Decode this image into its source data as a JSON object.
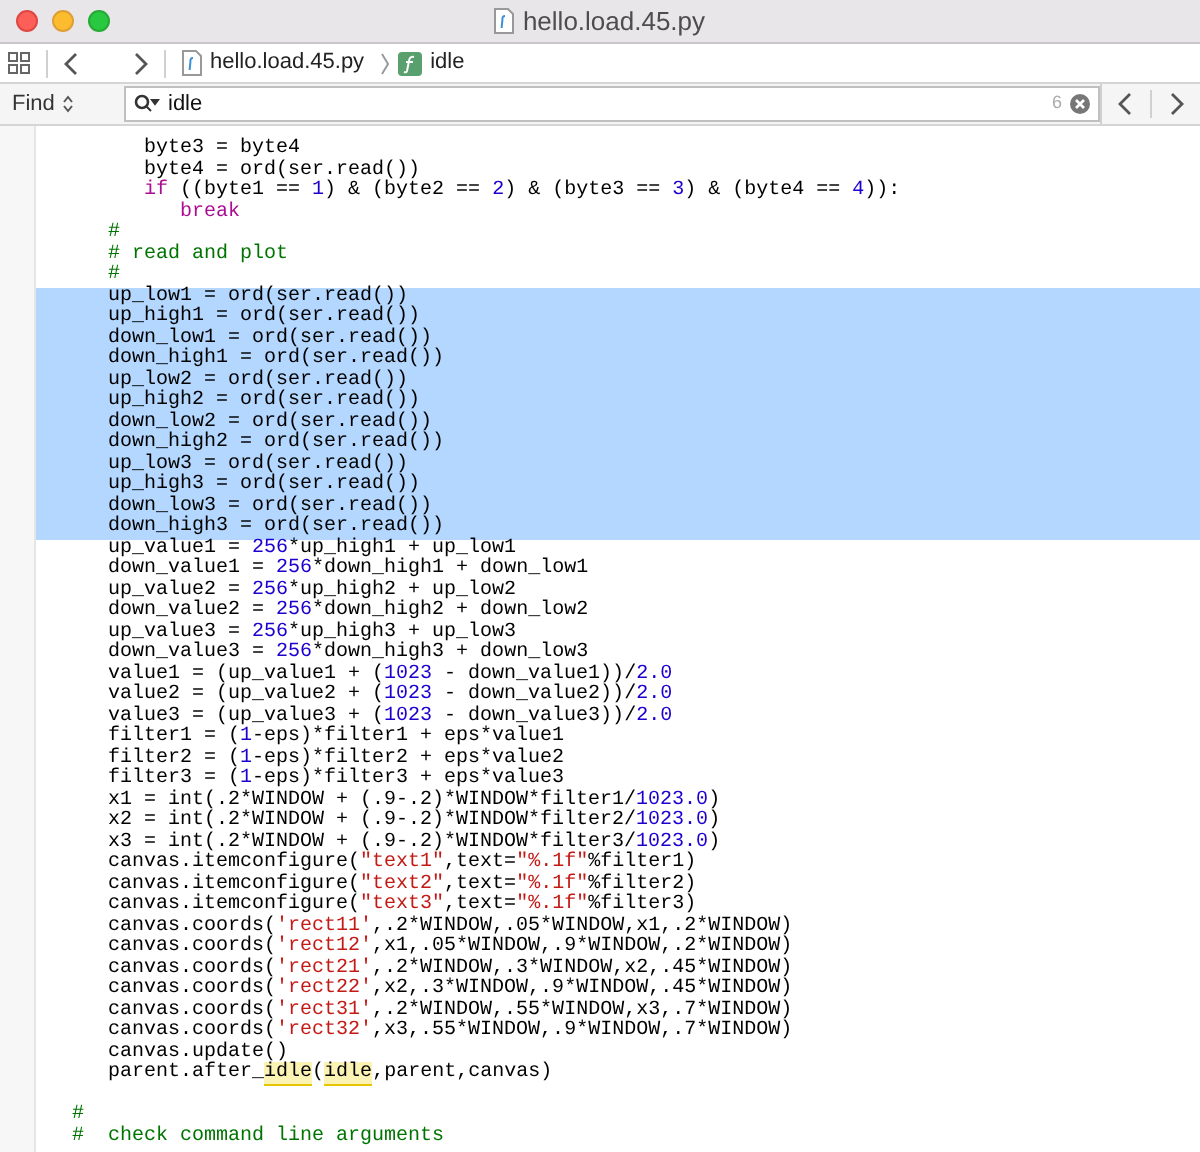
{
  "window": {
    "title": "hello.load.45.py"
  },
  "breadcrumb": [
    {
      "kind": "file",
      "label": "hello.load.45.py"
    },
    {
      "kind": "function",
      "label": "idle"
    }
  ],
  "find_bar": {
    "mode": "Find",
    "query": "idle",
    "match_count": "6"
  },
  "code_lines": [
    {
      "selected": false,
      "tokens": [
        {
          "kind": "plain",
          "text": "      byte3 = byte4"
        }
      ]
    },
    {
      "selected": false,
      "tokens": [
        {
          "kind": "plain",
          "text": "      byte4 = ord(ser.read())"
        }
      ]
    },
    {
      "selected": false,
      "tokens": [
        {
          "kind": "keyword",
          "text": "      if"
        },
        {
          "kind": "plain",
          "text": " ((byte1 == "
        },
        {
          "kind": "number",
          "text": "1"
        },
        {
          "kind": "plain",
          "text": ") & (byte2 == "
        },
        {
          "kind": "number",
          "text": "2"
        },
        {
          "kind": "plain",
          "text": ") & (byte3 == "
        },
        {
          "kind": "number",
          "text": "3"
        },
        {
          "kind": "plain",
          "text": ") & (byte4 == "
        },
        {
          "kind": "number",
          "text": "4"
        },
        {
          "kind": "plain",
          "text": ")):"
        }
      ]
    },
    {
      "selected": false,
      "tokens": [
        {
          "kind": "keyword",
          "text": "         break"
        }
      ]
    },
    {
      "selected": false,
      "tokens": [
        {
          "kind": "comment",
          "text": "   #"
        }
      ]
    },
    {
      "selected": false,
      "tokens": [
        {
          "kind": "comment",
          "text": "   # read and plot"
        }
      ]
    },
    {
      "selected": false,
      "tokens": [
        {
          "kind": "comment",
          "text": "   #"
        }
      ]
    },
    {
      "selected": true,
      "tokens": [
        {
          "kind": "plain",
          "text": "   up_low1 = ord(ser.read())"
        }
      ]
    },
    {
      "selected": true,
      "tokens": [
        {
          "kind": "plain",
          "text": "   up_high1 = ord(ser.read())"
        }
      ]
    },
    {
      "selected": true,
      "tokens": [
        {
          "kind": "plain",
          "text": "   down_low1 = ord(ser.read())"
        }
      ]
    },
    {
      "selected": true,
      "tokens": [
        {
          "kind": "plain",
          "text": "   down_high1 = ord(ser.read())"
        }
      ]
    },
    {
      "selected": true,
      "tokens": [
        {
          "kind": "plain",
          "text": "   up_low2 = ord(ser.read())"
        }
      ]
    },
    {
      "selected": true,
      "tokens": [
        {
          "kind": "plain",
          "text": "   up_high2 = ord(ser.read())"
        }
      ]
    },
    {
      "selected": true,
      "tokens": [
        {
          "kind": "plain",
          "text": "   down_low2 = ord(ser.read())"
        }
      ]
    },
    {
      "selected": true,
      "tokens": [
        {
          "kind": "plain",
          "text": "   down_high2 = ord(ser.read())"
        }
      ]
    },
    {
      "selected": true,
      "tokens": [
        {
          "kind": "plain",
          "text": "   up_low3 = ord(ser.read())"
        }
      ]
    },
    {
      "selected": true,
      "tokens": [
        {
          "kind": "plain",
          "text": "   up_high3 = ord(ser.read())"
        }
      ]
    },
    {
      "selected": true,
      "tokens": [
        {
          "kind": "plain",
          "text": "   down_low3 = ord(ser.read())"
        }
      ]
    },
    {
      "selected": true,
      "tokens": [
        {
          "kind": "plain",
          "text": "   down_high3 = ord(ser.read())"
        }
      ]
    },
    {
      "selected": false,
      "tokens": [
        {
          "kind": "plain",
          "text": "   up_value1 = "
        },
        {
          "kind": "number",
          "text": "256"
        },
        {
          "kind": "plain",
          "text": "*up_high1 + up_low1"
        }
      ]
    },
    {
      "selected": false,
      "tokens": [
        {
          "kind": "plain",
          "text": "   down_value1 = "
        },
        {
          "kind": "number",
          "text": "256"
        },
        {
          "kind": "plain",
          "text": "*down_high1 + down_low1"
        }
      ]
    },
    {
      "selected": false,
      "tokens": [
        {
          "kind": "plain",
          "text": "   up_value2 = "
        },
        {
          "kind": "number",
          "text": "256"
        },
        {
          "kind": "plain",
          "text": "*up_high2 + up_low2"
        }
      ]
    },
    {
      "selected": false,
      "tokens": [
        {
          "kind": "plain",
          "text": "   down_value2 = "
        },
        {
          "kind": "number",
          "text": "256"
        },
        {
          "kind": "plain",
          "text": "*down_high2 + down_low2"
        }
      ]
    },
    {
      "selected": false,
      "tokens": [
        {
          "kind": "plain",
          "text": "   up_value3 = "
        },
        {
          "kind": "number",
          "text": "256"
        },
        {
          "kind": "plain",
          "text": "*up_high3 + up_low3"
        }
      ]
    },
    {
      "selected": false,
      "tokens": [
        {
          "kind": "plain",
          "text": "   down_value3 = "
        },
        {
          "kind": "number",
          "text": "256"
        },
        {
          "kind": "plain",
          "text": "*down_high3 + down_low3"
        }
      ]
    },
    {
      "selected": false,
      "tokens": [
        {
          "kind": "plain",
          "text": "   value1 = (up_value1 + ("
        },
        {
          "kind": "number",
          "text": "1023"
        },
        {
          "kind": "plain",
          "text": " - down_value1))/"
        },
        {
          "kind": "number",
          "text": "2.0"
        }
      ]
    },
    {
      "selected": false,
      "tokens": [
        {
          "kind": "plain",
          "text": "   value2 = (up_value2 + ("
        },
        {
          "kind": "number",
          "text": "1023"
        },
        {
          "kind": "plain",
          "text": " - down_value2))/"
        },
        {
          "kind": "number",
          "text": "2.0"
        }
      ]
    },
    {
      "selected": false,
      "tokens": [
        {
          "kind": "plain",
          "text": "   value3 = (up_value3 + ("
        },
        {
          "kind": "number",
          "text": "1023"
        },
        {
          "kind": "plain",
          "text": " - down_value3))/"
        },
        {
          "kind": "number",
          "text": "2.0"
        }
      ]
    },
    {
      "selected": false,
      "tokens": [
        {
          "kind": "plain",
          "text": "   filter1 = ("
        },
        {
          "kind": "number",
          "text": "1"
        },
        {
          "kind": "plain",
          "text": "-eps)*filter1 + eps*value1"
        }
      ]
    },
    {
      "selected": false,
      "tokens": [
        {
          "kind": "plain",
          "text": "   filter2 = ("
        },
        {
          "kind": "number",
          "text": "1"
        },
        {
          "kind": "plain",
          "text": "-eps)*filter2 + eps*value2"
        }
      ]
    },
    {
      "selected": false,
      "tokens": [
        {
          "kind": "plain",
          "text": "   filter3 = ("
        },
        {
          "kind": "number",
          "text": "1"
        },
        {
          "kind": "plain",
          "text": "-eps)*filter3 + eps*value3"
        }
      ]
    },
    {
      "selected": false,
      "tokens": [
        {
          "kind": "plain",
          "text": "   x1 = int(.2*WINDOW + (.9-.2)*WINDOW*filter1/"
        },
        {
          "kind": "number",
          "text": "1023.0"
        },
        {
          "kind": "plain",
          "text": ")"
        }
      ]
    },
    {
      "selected": false,
      "tokens": [
        {
          "kind": "plain",
          "text": "   x2 = int(.2*WINDOW + (.9-.2)*WINDOW*filter2/"
        },
        {
          "kind": "number",
          "text": "1023.0"
        },
        {
          "kind": "plain",
          "text": ")"
        }
      ]
    },
    {
      "selected": false,
      "tokens": [
        {
          "kind": "plain",
          "text": "   x3 = int(.2*WINDOW + (.9-.2)*WINDOW*filter3/"
        },
        {
          "kind": "number",
          "text": "1023.0"
        },
        {
          "kind": "plain",
          "text": ")"
        }
      ]
    },
    {
      "selected": false,
      "tokens": [
        {
          "kind": "plain",
          "text": "   canvas.itemconfigure("
        },
        {
          "kind": "string",
          "text": "\"text1\""
        },
        {
          "kind": "plain",
          "text": ",text="
        },
        {
          "kind": "string",
          "text": "\"%.1f\""
        },
        {
          "kind": "plain",
          "text": "%filter1)"
        }
      ]
    },
    {
      "selected": false,
      "tokens": [
        {
          "kind": "plain",
          "text": "   canvas.itemconfigure("
        },
        {
          "kind": "string",
          "text": "\"text2\""
        },
        {
          "kind": "plain",
          "text": ",text="
        },
        {
          "kind": "string",
          "text": "\"%.1f\""
        },
        {
          "kind": "plain",
          "text": "%filter2)"
        }
      ]
    },
    {
      "selected": false,
      "tokens": [
        {
          "kind": "plain",
          "text": "   canvas.itemconfigure("
        },
        {
          "kind": "string",
          "text": "\"text3\""
        },
        {
          "kind": "plain",
          "text": ",text="
        },
        {
          "kind": "string",
          "text": "\"%.1f\""
        },
        {
          "kind": "plain",
          "text": "%filter3)"
        }
      ]
    },
    {
      "selected": false,
      "tokens": [
        {
          "kind": "plain",
          "text": "   canvas.coords("
        },
        {
          "kind": "string",
          "text": "'rect11'"
        },
        {
          "kind": "plain",
          "text": ",.2*WINDOW,.05*WINDOW,x1,.2*WINDOW)"
        }
      ]
    },
    {
      "selected": false,
      "tokens": [
        {
          "kind": "plain",
          "text": "   canvas.coords("
        },
        {
          "kind": "string",
          "text": "'rect12'"
        },
        {
          "kind": "plain",
          "text": ",x1,.05*WINDOW,.9*WINDOW,.2*WINDOW)"
        }
      ]
    },
    {
      "selected": false,
      "tokens": [
        {
          "kind": "plain",
          "text": "   canvas.coords("
        },
        {
          "kind": "string",
          "text": "'rect21'"
        },
        {
          "kind": "plain",
          "text": ",.2*WINDOW,.3*WINDOW,x2,.45*WINDOW)"
        }
      ]
    },
    {
      "selected": false,
      "tokens": [
        {
          "kind": "plain",
          "text": "   canvas.coords("
        },
        {
          "kind": "string",
          "text": "'rect22'"
        },
        {
          "kind": "plain",
          "text": ",x2,.3*WINDOW,.9*WINDOW,.45*WINDOW)"
        }
      ]
    },
    {
      "selected": false,
      "tokens": [
        {
          "kind": "plain",
          "text": "   canvas.coords("
        },
        {
          "kind": "string",
          "text": "'rect31'"
        },
        {
          "kind": "plain",
          "text": ",.2*WINDOW,.55*WINDOW,x3,.7*WINDOW)"
        }
      ]
    },
    {
      "selected": false,
      "tokens": [
        {
          "kind": "plain",
          "text": "   canvas.coords("
        },
        {
          "kind": "string",
          "text": "'rect32'"
        },
        {
          "kind": "plain",
          "text": ",x3,.55*WINDOW,.9*WINDOW,.7*WINDOW)"
        }
      ]
    },
    {
      "selected": false,
      "tokens": [
        {
          "kind": "plain",
          "text": "   canvas.update()"
        }
      ]
    },
    {
      "selected": false,
      "tokens": [
        {
          "kind": "plain",
          "text": "   parent.after_"
        },
        {
          "kind": "match",
          "text": "idle"
        },
        {
          "kind": "plain",
          "text": "("
        },
        {
          "kind": "match",
          "text": "idle"
        },
        {
          "kind": "plain",
          "text": ",parent,canvas)"
        }
      ]
    },
    {
      "kind": "blank"
    },
    {
      "selected": false,
      "tokens": [
        {
          "kind": "comment",
          "text": "#"
        }
      ]
    },
    {
      "selected": false,
      "tokens": [
        {
          "kind": "comment",
          "text": "#  check command line arguments"
        }
      ]
    }
  ]
}
